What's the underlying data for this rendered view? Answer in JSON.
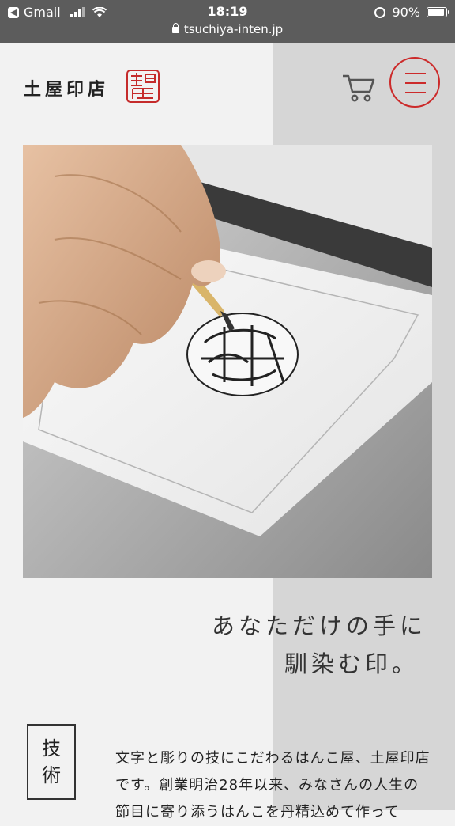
{
  "status_bar": {
    "back_app": "Gmail",
    "time": "18:19",
    "battery": "90%",
    "battery_level": 0.9,
    "url": "tsuchiya-inten.jp"
  },
  "header": {
    "logo_text": "土屋印店",
    "seal_glyph": "土屋",
    "icons": [
      "cart-icon",
      "menu-icon"
    ]
  },
  "hero": {
    "seal_glyph": "土屋"
  },
  "catch": {
    "line1": "あなただけの手に",
    "line2": "馴染む印。"
  },
  "tech": {
    "box_line1": "技",
    "box_line2": "術",
    "paragraph": "文字と彫りの技にこだわるはんこ屋、土屋印店です。創業明治28年以来、みなさんの人生の節目に寄り添うはんこを丹精込めて作って"
  },
  "colors": {
    "accent": "#cc2a2a",
    "status_bar": "#5c5c5c",
    "band": "#d6d6d6"
  }
}
